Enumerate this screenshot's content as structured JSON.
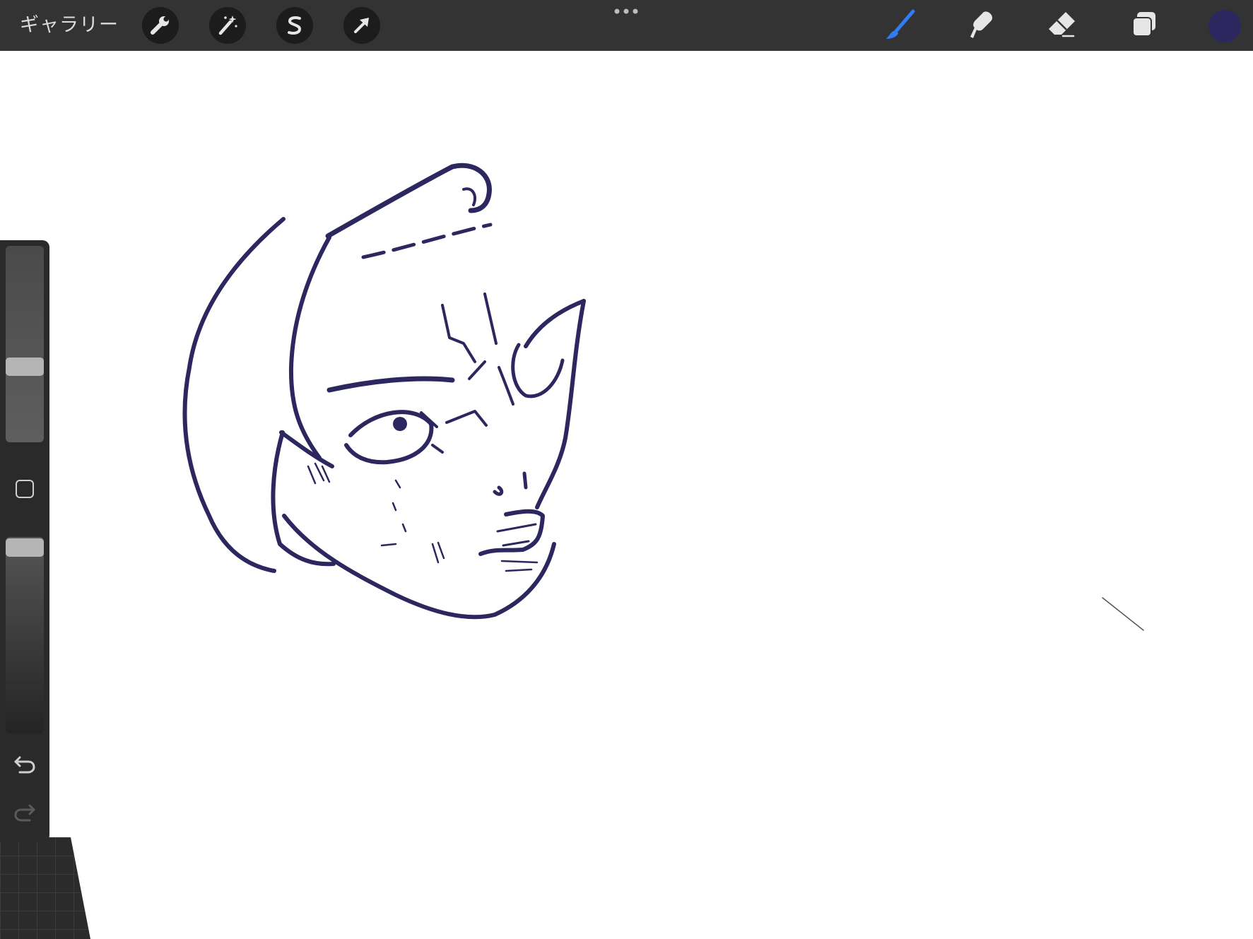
{
  "topbar": {
    "gallery_label": "ギャラリー",
    "tools_left": [
      {
        "name": "actions",
        "icon": "wrench-icon"
      },
      {
        "name": "adjustments",
        "icon": "magic-wand-icon"
      },
      {
        "name": "selection",
        "icon": "selection-s-icon"
      },
      {
        "name": "transform",
        "icon": "arrow-cursor-icon"
      }
    ],
    "more_icon": "ellipsis-icon",
    "tools_right": [
      {
        "name": "brush",
        "icon": "brush-icon",
        "active": true
      },
      {
        "name": "smudge",
        "icon": "smudge-icon",
        "active": false
      },
      {
        "name": "eraser",
        "icon": "eraser-icon",
        "active": false
      },
      {
        "name": "layers",
        "icon": "layers-icon",
        "active": false
      }
    ],
    "current_color": "#2d2760"
  },
  "sidebar": {
    "brush_size_level": 0.37,
    "brush_opacity_level": 1.0,
    "modify_icon": "square-icon",
    "undo_icon": "undo-icon",
    "redo_icon": "redo-icon"
  },
  "colors": {
    "toolbar_bg": "#333333",
    "tool_circle_bg": "#1c1c1c",
    "active_tool_blue": "#2f7cf6",
    "inactive_tool": "#e6e6e6",
    "ink": "#2d2760",
    "canvas": "#ffffff"
  }
}
